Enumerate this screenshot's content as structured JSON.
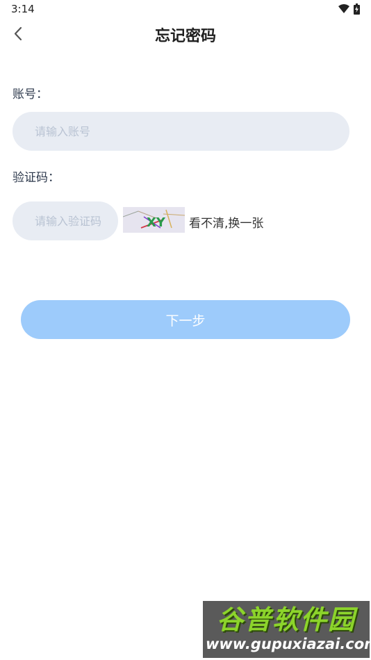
{
  "status_bar": {
    "time": "3:14",
    "icons": [
      "wifi-icon",
      "battery-icon"
    ]
  },
  "header": {
    "back_icon": "chevron-left-icon",
    "title": "忘记密码"
  },
  "form": {
    "account_label": "账号：",
    "account_placeholder": "请输入账号",
    "account_value": "",
    "captcha_label": "验证码：",
    "captcha_placeholder": "请输入验证码",
    "captcha_value": "",
    "captcha_image_text": "XY",
    "captcha_refresh_label": "看不清,换一张",
    "next_label": "下一步"
  },
  "watermark": {
    "title": "谷普软件园",
    "url": "www.gupuxiazai.com"
  },
  "colors": {
    "input_bg": "#e8ecf3",
    "placeholder": "#b9c3d3",
    "primary_button": "#9dcbfb",
    "label_text": "#2e3a4d"
  }
}
